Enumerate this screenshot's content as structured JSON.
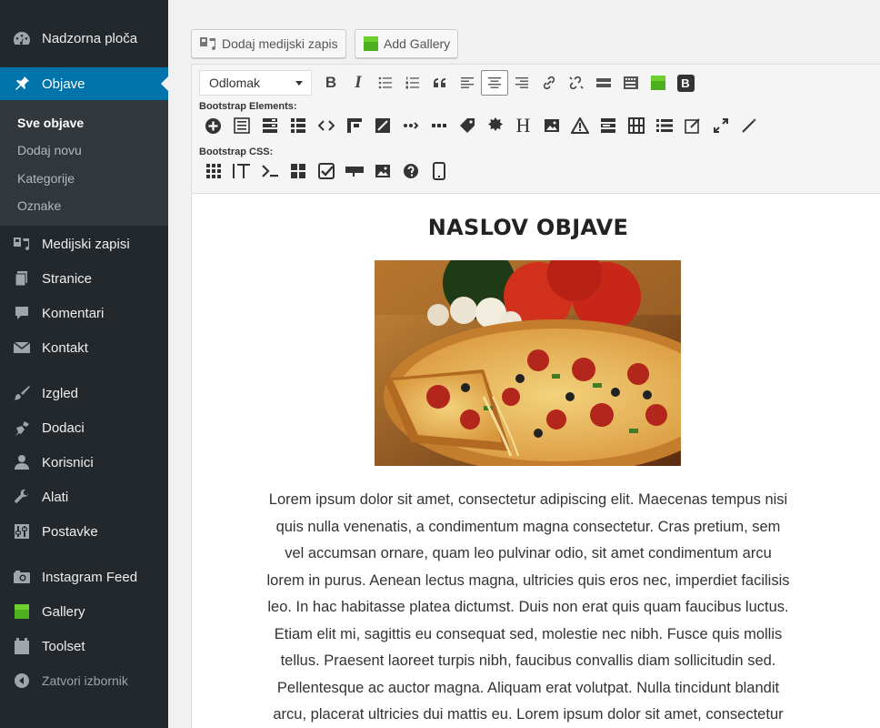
{
  "sidebar": {
    "items": [
      {
        "label": "Nadzorna ploča",
        "icon": "dashboard-icon"
      },
      {
        "label": "Objave",
        "icon": "pin-icon",
        "active": true
      },
      {
        "label": "Medijski zapisi",
        "icon": "media-icon"
      },
      {
        "label": "Stranice",
        "icon": "pages-icon"
      },
      {
        "label": "Komentari",
        "icon": "comments-icon"
      },
      {
        "label": "Kontakt",
        "icon": "mail-icon"
      },
      {
        "label": "Izgled",
        "icon": "brush-icon"
      },
      {
        "label": "Dodaci",
        "icon": "plugin-icon"
      },
      {
        "label": "Korisnici",
        "icon": "users-icon"
      },
      {
        "label": "Alati",
        "icon": "wrench-icon"
      },
      {
        "label": "Postavke",
        "icon": "settings-icon"
      },
      {
        "label": "Instagram Feed",
        "icon": "camera-icon"
      },
      {
        "label": "Gallery",
        "icon": "gallery-icon"
      },
      {
        "label": "Toolset",
        "icon": "toolset-icon"
      },
      {
        "label": "Zatvori izbornik",
        "icon": "collapse-icon"
      }
    ],
    "submenu": [
      "Sve objave",
      "Dodaj novu",
      "Kategorije",
      "Oznake"
    ]
  },
  "media_buttons": {
    "add_media": "Dodaj medijski zapis",
    "add_gallery": "Add Gallery"
  },
  "toolbar": {
    "format_select": "Odlomak",
    "bootstrap_elements_label": "Bootstrap Elements:",
    "bootstrap_css_label": "Bootstrap CSS:",
    "bold": "B",
    "italic": "I",
    "heading_glyph": "H",
    "bootstrap_badge": "B"
  },
  "post": {
    "title": "NASLOV OBJAVE",
    "image": "pizza-photo",
    "lines": [
      "Lorem ipsum dolor sit amet, consectetur adipiscing elit. Maecenas tempus nisi",
      "quis nulla venenatis, a condimentum magna consectetur. Cras pretium, sem",
      "vel accumsan ornare, quam leo pulvinar odio, sit amet condimentum arcu",
      "lorem in purus. Aenean lectus magna, ultricies quis eros nec, imperdiet facilisis",
      "leo. In hac habitasse platea dictumst. Duis non erat quis quam faucibus luctus.",
      "Etiam elit mi, sagittis eu consequat sed, molestie nec nibh. Fusce quis mollis",
      "tellus. Praesent laoreet turpis nibh, faucibus convallis diam sollicitudin sed.",
      "Pellentesque ac auctor magna. Aliquam erat volutpat. Nulla tincidunt blandit",
      "arcu, placerat ultricies dui mattis eu. Lorem ipsum dolor sit amet, consectetur"
    ]
  },
  "colors": {
    "sidebar_bg": "#23282d",
    "active_blue": "#0073aa",
    "spell_red": "#d63638"
  }
}
